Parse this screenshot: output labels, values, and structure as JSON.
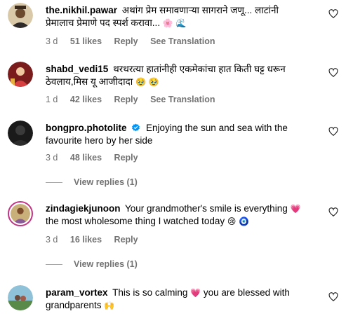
{
  "comments": [
    {
      "username": "the.nikhil.pawar",
      "text_line1": "अथांग प्रेम समावणाऱ्या सागराने जणू... लाटांनी",
      "text_line2": "प्रेमालाच प्रेमाणे पद स्पर्श करावा...",
      "emoji": "🌸 🌊",
      "time": "3 d",
      "likes": "51 likes",
      "reply": "Reply",
      "see_translation": "See Translation"
    },
    {
      "username": "shabd_vedi15",
      "text_line1": "थरथरत्या हातांनीही एकमेकांचा हात किती घट्ट धरून",
      "text_line2": "ठेवलाय,मिस यू आजीदादा",
      "emoji": "🥹 🥹",
      "time": "1 d",
      "likes": "42 likes",
      "reply": "Reply",
      "see_translation": "See Translation"
    },
    {
      "username": "bongpro.photolite",
      "text_line1": "Enjoying the sun and sea with the",
      "text_line2": "favourite hero by her side",
      "time": "3 d",
      "likes": "48 likes",
      "reply": "Reply",
      "view_replies": "View replies (1)"
    },
    {
      "username": "zindagiekjunoon",
      "text_line1": "Your grandmother's smile is everything",
      "text_line1_emoji": "💗",
      "text_line2": "the most wholesome thing I watched today",
      "emoji": "😢 🧿",
      "time": "3 d",
      "likes": "16 likes",
      "reply": "Reply",
      "view_replies": "View replies (1)"
    },
    {
      "username": "param_vortex",
      "text_line1": "This is so calming",
      "text_line1_emoji": "💗",
      "text_line1_rest": "you are blessed with",
      "text_line2": "grandparents",
      "emoji": "🙌"
    }
  ],
  "colors": {
    "meta_text": "#737373",
    "verified_blue": "#0095f6",
    "story_ring": "#c13584"
  },
  "icons": {
    "like": "heart-outline-icon",
    "verified": "verified-badge-icon"
  }
}
